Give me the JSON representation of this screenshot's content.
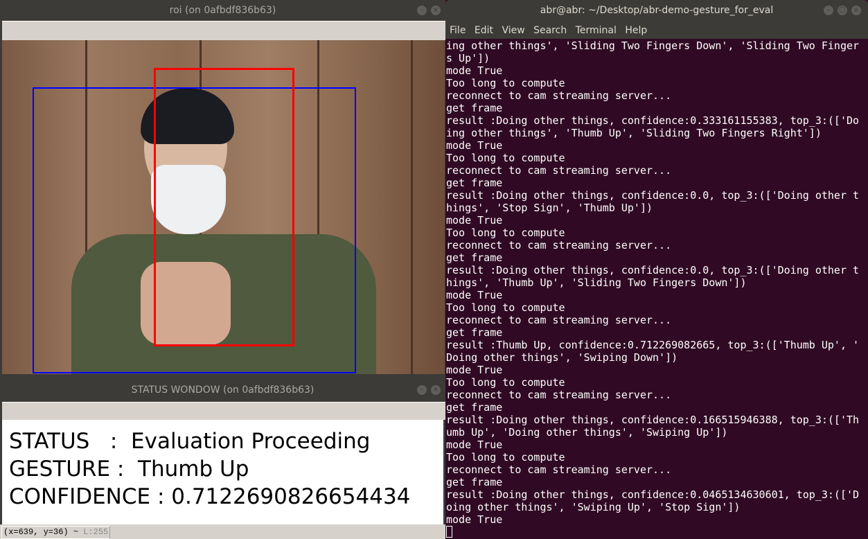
{
  "roi_window": {
    "title": "roi (on 0afbdf836b63)",
    "box_colors": {
      "face": "#0000ff",
      "hand": "#ff0000"
    }
  },
  "status_window": {
    "title": "STATUS WONDOW (on 0afbdf836b63)",
    "status_line": "STATUS   :  Evaluation Proceeding",
    "gesture_line": "GESTURE :  Thumb Up",
    "confidence_line": "CONFIDENCE : 0.7122690826654434",
    "coord_readout": "(x=639, y=36) ~",
    "level_readout": "L:255"
  },
  "terminal": {
    "title": "abr@abr: ~/Desktop/abr-demo-gesture_for_eval",
    "menu": [
      "File",
      "Edit",
      "View",
      "Search",
      "Terminal",
      "Help"
    ],
    "lines": [
      "ing other things', 'Sliding Two Fingers Down', 'Sliding Two Finger",
      "s Up'])",
      "mode True",
      "Too long to compute",
      "reconnect to cam streaming server...",
      "get frame",
      "result :Doing other things, confidence:0.333161155383, top_3:(['Do",
      "ing other things', 'Thumb Up', 'Sliding Two Fingers Right'])",
      "mode True",
      "Too long to compute",
      "reconnect to cam streaming server...",
      "get frame",
      "result :Doing other things, confidence:0.0, top_3:(['Doing other t",
      "hings', 'Stop Sign', 'Thumb Up'])",
      "mode True",
      "Too long to compute",
      "reconnect to cam streaming server...",
      "get frame",
      "result :Doing other things, confidence:0.0, top_3:(['Doing other t",
      "hings', 'Thumb Up', 'Sliding Two Fingers Down'])",
      "mode True",
      "Too long to compute",
      "reconnect to cam streaming server...",
      "get frame",
      "result :Thumb Up, confidence:0.712269082665, top_3:(['Thumb Up', '",
      "Doing other things', 'Swiping Down'])",
      "mode True",
      "Too long to compute",
      "reconnect to cam streaming server...",
      "get frame",
      "result :Doing other things, confidence:0.166515946388, top_3:(['Th",
      "umb Up', 'Doing other things', 'Swiping Up'])",
      "mode True",
      "Too long to compute",
      "reconnect to cam streaming server...",
      "get frame",
      "result :Doing other things, confidence:0.0465134630601, top_3:(['D",
      "oing other things', 'Swiping Up', 'Stop Sign'])",
      "mode True"
    ]
  }
}
